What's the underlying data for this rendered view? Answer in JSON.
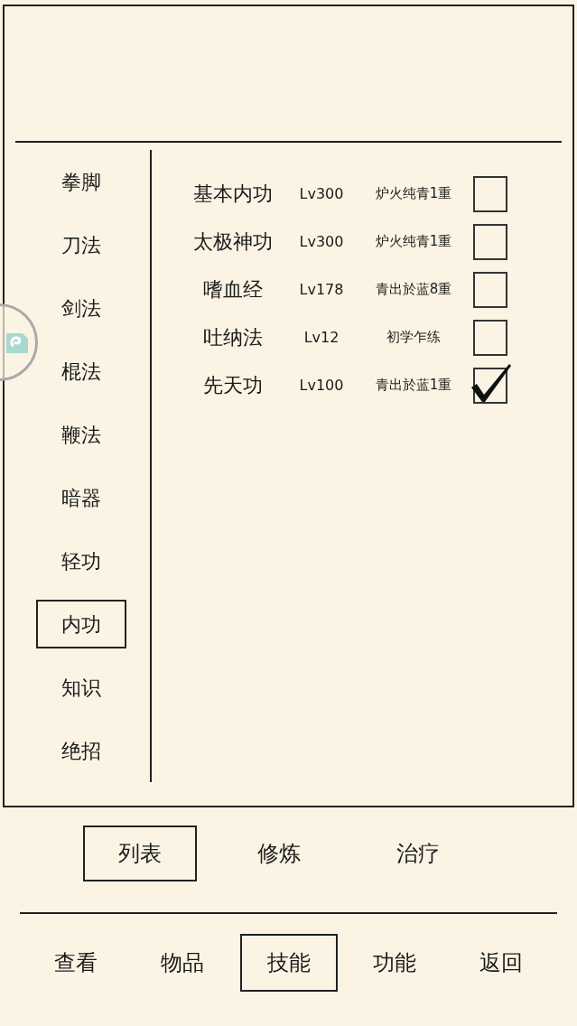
{
  "categories": [
    {
      "label": "拳脚",
      "selected": false
    },
    {
      "label": "刀法",
      "selected": false
    },
    {
      "label": "剑法",
      "selected": false
    },
    {
      "label": "棍法",
      "selected": false
    },
    {
      "label": "鞭法",
      "selected": false
    },
    {
      "label": "暗器",
      "selected": false
    },
    {
      "label": "轻功",
      "selected": false
    },
    {
      "label": "内功",
      "selected": true
    },
    {
      "label": "知识",
      "selected": false
    },
    {
      "label": "绝招",
      "selected": false
    }
  ],
  "skills": [
    {
      "name": "基本内功",
      "level": "Lv300",
      "stage": "炉火纯青1重",
      "checked": false
    },
    {
      "name": "太极神功",
      "level": "Lv300",
      "stage": "炉火纯青1重",
      "checked": false
    },
    {
      "name": "嗜血经",
      "level": "Lv178",
      "stage": "青出於蓝8重",
      "checked": false
    },
    {
      "name": "吐纳法",
      "level": "Lv12",
      "stage": "初学乍练",
      "checked": false
    },
    {
      "name": "先天功",
      "level": "Lv100",
      "stage": "青出於蓝1重",
      "checked": true
    }
  ],
  "sub_tabs": [
    {
      "label": "列表",
      "selected": true
    },
    {
      "label": "修炼",
      "selected": false
    },
    {
      "label": "治疗",
      "selected": false
    }
  ],
  "nav": [
    {
      "label": "查看",
      "selected": false
    },
    {
      "label": "物品",
      "selected": false
    },
    {
      "label": "技能",
      "selected": true
    },
    {
      "label": "功能",
      "selected": false
    },
    {
      "label": "返回",
      "selected": false
    }
  ]
}
